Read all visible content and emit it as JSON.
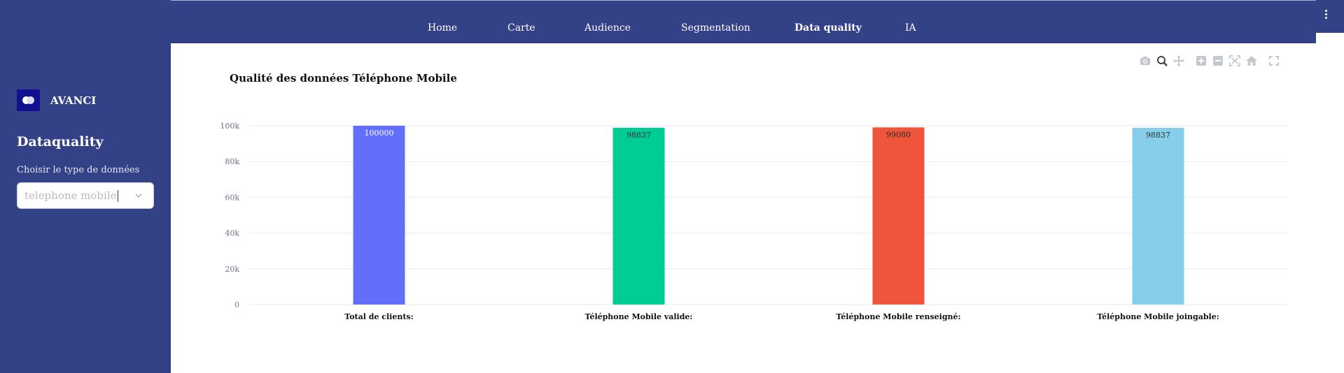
{
  "sidebar": {
    "brand": "AVANCI",
    "title": "Dataquality",
    "select_label": "Choisir le type de données",
    "select_value": "telephone mobile"
  },
  "nav": {
    "items": [
      "Home",
      "Carte",
      "Audience",
      "Segmentation",
      "Data quality",
      "IA"
    ],
    "active": "Data quality"
  },
  "modebar": {
    "icons": [
      "camera-icon",
      "zoom-icon",
      "pan-icon",
      "zoom-in-icon",
      "zoom-out-icon",
      "autoscale-icon",
      "home-icon",
      "fullscreen-icon"
    ]
  },
  "chart_data": {
    "type": "bar",
    "title": "Qualité des données Téléphone Mobile",
    "categories": [
      "Total de clients:",
      "Téléphone Mobile valide:",
      "Téléphone Mobile renseigné:",
      "Téléphone Mobile joingable:"
    ],
    "values": [
      100000,
      98837,
      99080,
      98837
    ],
    "data_labels": [
      "100000",
      "98837",
      "99080",
      "98837"
    ],
    "colors": [
      "#636efa",
      "#00cc96",
      "#ef553b",
      "#87ceeb"
    ],
    "label_colors": [
      "#ffffff",
      "#2b2b2b",
      "#2b2b2b",
      "#2b2b2b"
    ],
    "ylim": [
      0,
      100000
    ],
    "yticks": [
      0,
      20000,
      40000,
      60000,
      80000,
      100000
    ],
    "ytick_labels": [
      "0",
      "20k",
      "40k",
      "60k",
      "80k",
      "100k"
    ],
    "grid": true,
    "xlabel": "",
    "ylabel": ""
  }
}
